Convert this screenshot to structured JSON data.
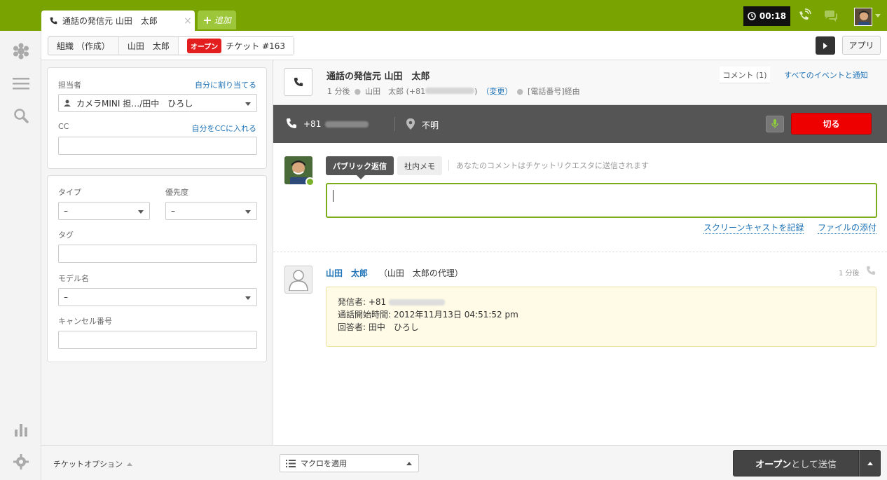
{
  "tabs": {
    "active_title": "通話の発信元 山田　太郎",
    "add_label": "追加"
  },
  "top": {
    "timer": "00:18"
  },
  "breadcrumb": {
    "org": "組織 （作成）",
    "user": "山田　太郎",
    "status_badge": "オープン",
    "ticket": "チケット #163"
  },
  "toolbar": {
    "apps_label": "アプリ"
  },
  "properties": {
    "assignee_label": "担当者",
    "assign_self_link": "自分に割り当てる",
    "assignee_value": "カメラMINI 担…/田中　ひろし",
    "cc_label": "CC",
    "cc_self_link": "自分をCCに入れる",
    "type_label": "タイプ",
    "type_value": "–",
    "priority_label": "優先度",
    "priority_value": "–",
    "tags_label": "タグ",
    "model_label": "モデル名",
    "model_value": "–",
    "cancel_label": "キャンセル番号"
  },
  "header": {
    "title": "通話の発信元 山田　太郎",
    "time_ago": "1 分後",
    "requester": "山田　太郎 (+81",
    "requester_tail": ")",
    "change_link": "（変更）",
    "via": "[電話番号]経由",
    "comment_count": "コメント (1)",
    "all_events_link": "すべてのイベントと通知"
  },
  "call": {
    "number_prefix": "+81",
    "location": "不明",
    "hangup_label": "切る"
  },
  "reply": {
    "public_tab": "パブリック返信",
    "internal_tab": "社内メモ",
    "hint": "あなたのコメントはチケットリクエスタに送信されます",
    "screencast_link": "スクリーンキャストを記録",
    "attach_link": "ファイルの添付"
  },
  "event": {
    "author": "山田　太郎",
    "proxy": "（山田　太郎の代理）",
    "time_ago": "1 分後",
    "caller_line": "発信者: +81",
    "start_line": "通話開始時間: 2012年11月13日 04:51:52 pm",
    "answerer_line": "回答者: 田中　ひろし"
  },
  "bottom": {
    "ticket_options": "チケットオプション",
    "macro_label": "マクロを適用",
    "submit_bold": "オープン",
    "submit_rest": "として送信"
  },
  "colors": {
    "brand_green": "#78a300",
    "link_blue": "#1f73b7",
    "hangup_red": "#e00000",
    "status_red": "#e31e1e"
  }
}
